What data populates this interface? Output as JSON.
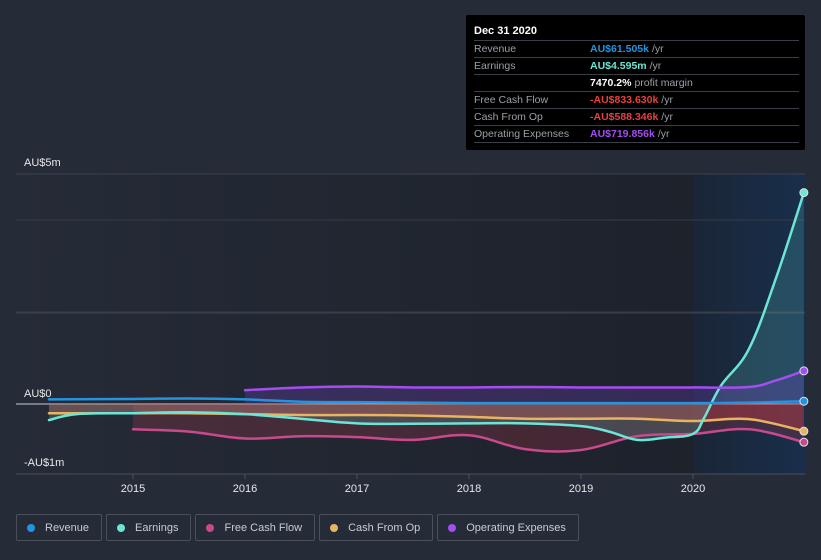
{
  "tooltip": {
    "date": "Dec 31 2020",
    "rows": [
      {
        "label": "Revenue",
        "value": "AU$61.505k",
        "unit": "/yr",
        "color": "#2394df"
      },
      {
        "label": "Earnings",
        "value": "AU$4.595m",
        "unit": "/yr",
        "color": "#6ce5d6"
      },
      {
        "label": "",
        "value": "7470.2%",
        "unit": "profit margin",
        "color": "#ffffff"
      },
      {
        "label": "Free Cash Flow",
        "value": "-AU$833.630k",
        "unit": "/yr",
        "color": "#e6403f"
      },
      {
        "label": "Cash From Op",
        "value": "-AU$588.346k",
        "unit": "/yr",
        "color": "#e6403f"
      },
      {
        "label": "Operating Expenses",
        "value": "AU$719.856k",
        "unit": "/yr",
        "color": "#a34ef0"
      }
    ]
  },
  "legend": [
    {
      "label": "Revenue",
      "color": "#2394df"
    },
    {
      "label": "Earnings",
      "color": "#6ce5d6"
    },
    {
      "label": "Free Cash Flow",
      "color": "#c94a8c"
    },
    {
      "label": "Cash From Op",
      "color": "#e8b462"
    },
    {
      "label": "Operating Expenses",
      "color": "#a34ef0"
    }
  ],
  "chart_data": {
    "type": "line",
    "title": "",
    "xlabel": "",
    "ylabel": "",
    "ylim": [
      -1.5,
      5
    ],
    "xlim": [
      2014.2,
      2021.0
    ],
    "y_tick_labels": [
      {
        "value": 5,
        "label": "AU$5m"
      },
      {
        "value": 0,
        "label": "AU$0"
      },
      {
        "value": -1,
        "label": "-AU$1m"
      }
    ],
    "x_ticks": [
      2015,
      2016,
      2017,
      2018,
      2019,
      2020
    ],
    "x_tick_labels": [
      "2015",
      "2016",
      "2017",
      "2018",
      "2019",
      "2020"
    ],
    "highlight_start": 2020.0,
    "units": "AU$ millions",
    "series": [
      {
        "name": "Revenue",
        "color": "#2394df",
        "x": [
          2014.25,
          2015.0,
          2015.5,
          2016.0,
          2016.5,
          2017.0,
          2017.5,
          2018.0,
          2018.5,
          2019.0,
          2019.5,
          2020.0,
          2020.5,
          2021.0
        ],
        "values": [
          0.1,
          0.11,
          0.12,
          0.1,
          0.05,
          0.04,
          0.03,
          0.02,
          0.02,
          0.02,
          0.02,
          0.02,
          0.03,
          0.06
        ]
      },
      {
        "name": "Earnings",
        "color": "#6ce5d6",
        "x": [
          2014.25,
          2014.5,
          2015.0,
          2015.5,
          2016.0,
          2016.5,
          2017.0,
          2017.5,
          2018.0,
          2018.5,
          2019.0,
          2019.25,
          2019.5,
          2019.75,
          2020.0,
          2020.1,
          2020.25,
          2020.5,
          2020.75,
          2021.0
        ],
        "values": [
          -0.35,
          -0.22,
          -0.2,
          -0.18,
          -0.22,
          -0.32,
          -0.42,
          -0.43,
          -0.42,
          -0.42,
          -0.48,
          -0.6,
          -0.78,
          -0.73,
          -0.65,
          -0.3,
          0.4,
          1.2,
          2.8,
          4.595
        ]
      },
      {
        "name": "Free Cash Flow",
        "color": "#c94a8c",
        "x": [
          2015.0,
          2015.5,
          2016.0,
          2016.5,
          2017.0,
          2017.5,
          2018.0,
          2018.5,
          2019.0,
          2019.5,
          2020.0,
          2020.5,
          2021.0
        ],
        "values": [
          -0.55,
          -0.6,
          -0.75,
          -0.7,
          -0.72,
          -0.78,
          -0.68,
          -0.98,
          -1.0,
          -0.7,
          -0.65,
          -0.55,
          -0.83
        ]
      },
      {
        "name": "Cash From Op",
        "color": "#e8b462",
        "x": [
          2014.25,
          2015.0,
          2015.5,
          2016.0,
          2016.5,
          2017.0,
          2017.5,
          2018.0,
          2018.5,
          2019.0,
          2019.5,
          2020.0,
          2020.5,
          2021.0
        ],
        "values": [
          -0.2,
          -0.2,
          -0.2,
          -0.22,
          -0.24,
          -0.24,
          -0.25,
          -0.28,
          -0.32,
          -0.32,
          -0.32,
          -0.37,
          -0.33,
          -0.59
        ]
      },
      {
        "name": "Operating Expenses",
        "color": "#a34ef0",
        "x": [
          2016.0,
          2016.5,
          2017.0,
          2017.5,
          2018.0,
          2018.5,
          2019.0,
          2019.5,
          2020.0,
          2020.5,
          2020.75,
          2021.0
        ],
        "values": [
          0.3,
          0.36,
          0.38,
          0.36,
          0.36,
          0.37,
          0.36,
          0.36,
          0.36,
          0.37,
          0.52,
          0.72
        ]
      }
    ]
  }
}
